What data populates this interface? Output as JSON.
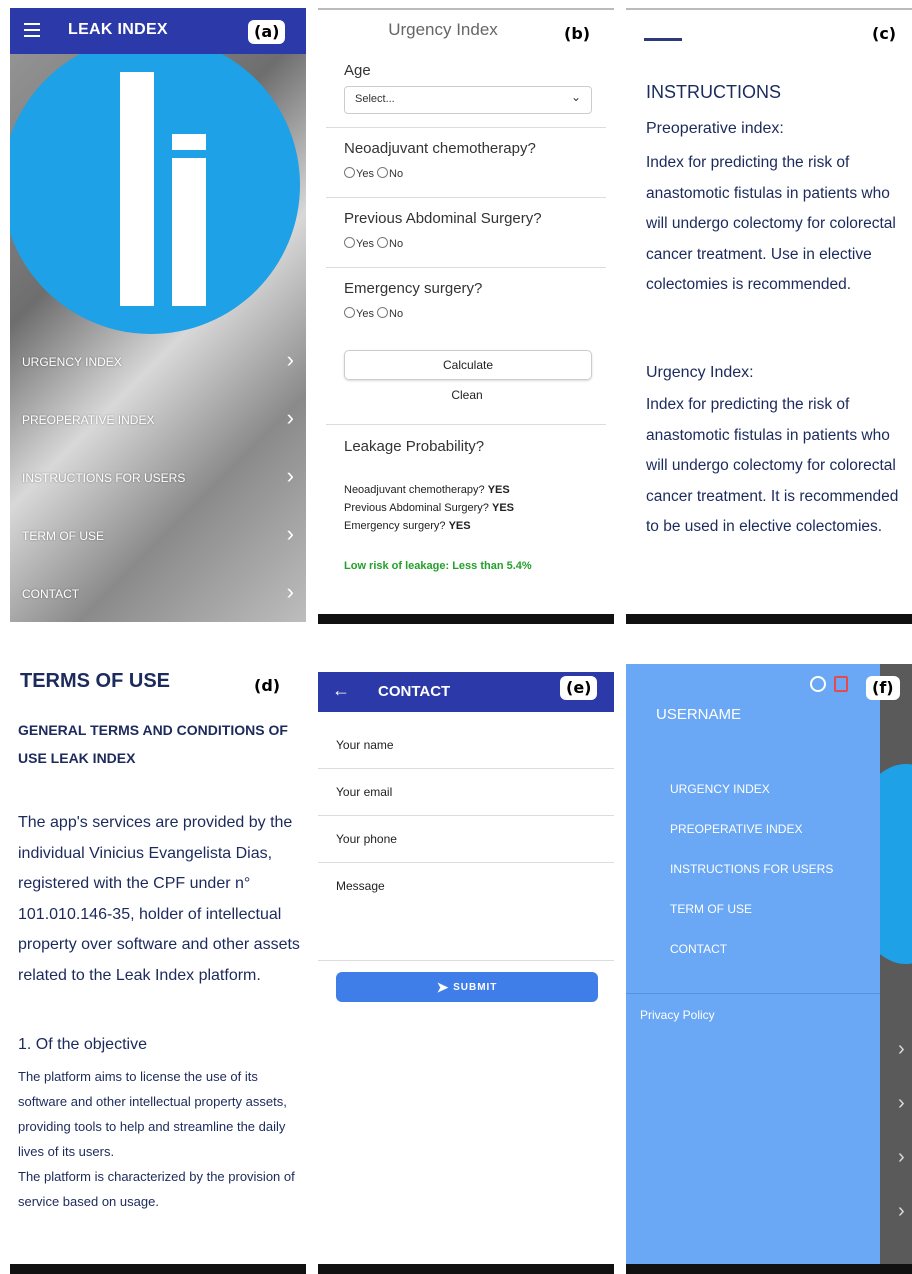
{
  "panels": {
    "a": {
      "tag": "(a)",
      "app_title": "LEAK INDEX",
      "nav_items": [
        {
          "label": "URGENCY INDEX"
        },
        {
          "label": "PREOPERATIVE INDEX"
        },
        {
          "label": "INSTRUCTIONS FOR USERS"
        },
        {
          "label": "TERM OF USE"
        },
        {
          "label": "CONTACT"
        }
      ]
    },
    "b": {
      "tag": "(b)",
      "title": "Urgency Index",
      "age_label": "Age",
      "age_value": "Select...",
      "questions": [
        "Neoadjuvant chemotherapy?",
        "Previous Abdominal Surgery?",
        "Emergency surgery?"
      ],
      "yes_label": "Yes",
      "no_label": "No",
      "calculate_label": "Calculate",
      "clean_label": "Clean",
      "result_title": "Leakage Probability?",
      "results": [
        {
          "q": "Neoadjuvant chemotherapy?",
          "a": "YES"
        },
        {
          "q": "Previous Abdominal Surgery?",
          "a": "YES"
        },
        {
          "q": "Emergency surgery?",
          "a": "YES"
        }
      ],
      "risk_text": "Low risk of leakage: Less than 5.4%",
      "risk_color": "#22a02a"
    },
    "c": {
      "tag": "(c)",
      "heading": "INSTRUCTIONS",
      "preop_title": "Preoperative index:",
      "preop_text": "Index for predicting the risk of anastomotic fistulas in patients who will undergo colectomy for colorectal cancer treatment. Use in elective colectomies is recommended.",
      "urgency_title": "Urgency Index:",
      "urgency_text": "Index for predicting the risk of anastomotic fistulas in patients who will undergo colectomy for colorectal cancer treatment. It is recommended to be used in elective colectomies."
    },
    "d": {
      "tag": "(d)",
      "heading": "TERMS OF USE",
      "subheading": "GENERAL TERMS AND CONDITIONS OF USE LEAK INDEX",
      "intro": "The app's services are provided by the individual Vinicius Evangelista Dias, registered with the CPF under n° 101.010.146-35, holder of intellectual property over software and other assets related to the Leak Index platform.",
      "section_title": "1. Of the objective",
      "section_text": "The platform aims to license the use of its software and other intellectual property assets, providing tools to help and streamline the daily lives of its users.\nThe platform is characterized by the provision of service based on usage."
    },
    "e": {
      "tag": "(e)",
      "app_title": "CONTACT",
      "fields": [
        "Your name",
        "Your email",
        "Your phone",
        "Message"
      ],
      "submit_label": "SUBMIT"
    },
    "f": {
      "tag": "(f)",
      "username": "USERNAME",
      "menu_items": [
        {
          "label": "URGENCY INDEX"
        },
        {
          "label": "PREOPERATIVE INDEX"
        },
        {
          "label": "INSTRUCTIONS FOR USERS"
        },
        {
          "label": "TERM OF USE"
        },
        {
          "label": "CONTACT"
        }
      ],
      "privacy_label": "Privacy Policy"
    }
  },
  "colors": {
    "app_bar": "#2b3aa8",
    "logo_blue": "#1ea1e6",
    "drawer": "#6aa7f4",
    "text_navy": "#1c2a5c",
    "submit": "#3f7ee8"
  },
  "icons": {
    "menu": "hamburger-menu-icon",
    "chevron": "chevron-right-icon",
    "back": "arrow-left-icon",
    "send": "send-icon",
    "user": "user-circle-icon",
    "logout": "logout-icon"
  }
}
